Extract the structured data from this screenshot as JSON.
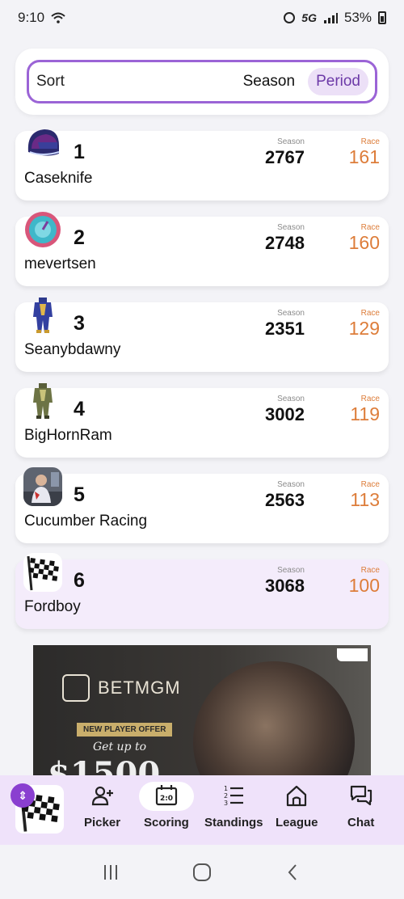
{
  "status_bar": {
    "time": "9:10",
    "network": "5G",
    "battery": "53%"
  },
  "sort": {
    "label": "Sort",
    "options": [
      "Season",
      "Period"
    ],
    "selected": "Period"
  },
  "labels": {
    "season": "Season",
    "race": "Race"
  },
  "rows": [
    {
      "rank": "1",
      "name": "Caseknife",
      "season": "2767",
      "race": "161",
      "avatar": "helmet-icon"
    },
    {
      "rank": "2",
      "name": "mevertsen",
      "season": "2748",
      "race": "160",
      "avatar": "gauge-icon"
    },
    {
      "rank": "3",
      "name": "Seanybdawny",
      "season": "2351",
      "race": "129",
      "avatar": "firesuit-icon"
    },
    {
      "rank": "4",
      "name": "BigHornRam",
      "season": "3002",
      "race": "119",
      "avatar": "firesuit-icon"
    },
    {
      "rank": "5",
      "name": "Cucumber Racing",
      "season": "2563",
      "race": "113",
      "avatar": "driver-photo"
    },
    {
      "rank": "6",
      "name": "Fordboy",
      "season": "3068",
      "race": "100",
      "avatar": "checkered-flag-icon"
    }
  ],
  "ad": {
    "brand": "BETMGM",
    "badge": "NEW PLAYER OFFER",
    "line": "Get up to",
    "amount": "$1500"
  },
  "bottom_nav": {
    "items": [
      {
        "label": "Picker",
        "icon": "add-user-icon"
      },
      {
        "label": "Scoring",
        "icon": "scoreboard-icon"
      },
      {
        "label": "Standings",
        "icon": "ranked-list-icon"
      },
      {
        "label": "League",
        "icon": "home-icon"
      },
      {
        "label": "Chat",
        "icon": "chat-icon"
      }
    ],
    "active": "Scoring"
  },
  "colors": {
    "accent": "#9b64d6",
    "race": "#dd7d3a",
    "nav_bg": "#efe2fa"
  }
}
